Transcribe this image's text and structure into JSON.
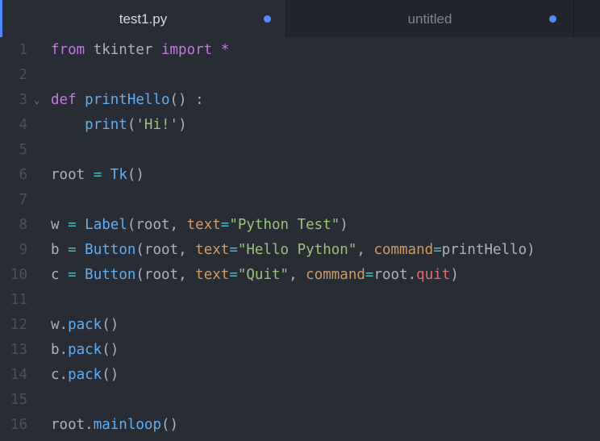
{
  "tabs": [
    {
      "label": "test1.py",
      "modified": true,
      "active": true
    },
    {
      "label": "untitled",
      "modified": true,
      "active": false
    }
  ],
  "line_numbers": [
    "1",
    "2",
    "3",
    "4",
    "5",
    "6",
    "7",
    "8",
    "9",
    "10",
    "11",
    "12",
    "13",
    "14",
    "15",
    "16"
  ],
  "fold_marker": "⌄",
  "code_lines": [
    [
      {
        "t": "from",
        "c": "kw"
      },
      {
        "t": " tkinter ",
        "c": "plain"
      },
      {
        "t": "import",
        "c": "kw"
      },
      {
        "t": " ",
        "c": "plain"
      },
      {
        "t": "*",
        "c": "kw"
      }
    ],
    [],
    [
      {
        "t": "def",
        "c": "kw"
      },
      {
        "t": " ",
        "c": "plain"
      },
      {
        "t": "printHello",
        "c": "fn"
      },
      {
        "t": "() :",
        "c": "plain"
      }
    ],
    [
      {
        "t": "    ",
        "c": "plain"
      },
      {
        "t": "print",
        "c": "fn"
      },
      {
        "t": "(",
        "c": "plain"
      },
      {
        "t": "'Hi!'",
        "c": "str"
      },
      {
        "t": ")",
        "c": "plain"
      }
    ],
    [],
    [
      {
        "t": "root ",
        "c": "plain"
      },
      {
        "t": "=",
        "c": "op"
      },
      {
        "t": " ",
        "c": "plain"
      },
      {
        "t": "Tk",
        "c": "fn"
      },
      {
        "t": "()",
        "c": "plain"
      }
    ],
    [],
    [
      {
        "t": "w ",
        "c": "plain"
      },
      {
        "t": "=",
        "c": "op"
      },
      {
        "t": " ",
        "c": "plain"
      },
      {
        "t": "Label",
        "c": "fn"
      },
      {
        "t": "(root, ",
        "c": "plain"
      },
      {
        "t": "text",
        "c": "kwarg"
      },
      {
        "t": "=",
        "c": "op"
      },
      {
        "t": "\"Python Test\"",
        "c": "str"
      },
      {
        "t": ")",
        "c": "plain"
      }
    ],
    [
      {
        "t": "b ",
        "c": "plain"
      },
      {
        "t": "=",
        "c": "op"
      },
      {
        "t": " ",
        "c": "plain"
      },
      {
        "t": "Button",
        "c": "fn"
      },
      {
        "t": "(root, ",
        "c": "plain"
      },
      {
        "t": "text",
        "c": "kwarg"
      },
      {
        "t": "=",
        "c": "op"
      },
      {
        "t": "\"Hello Python\"",
        "c": "str"
      },
      {
        "t": ", ",
        "c": "plain"
      },
      {
        "t": "command",
        "c": "kwarg"
      },
      {
        "t": "=",
        "c": "op"
      },
      {
        "t": "printHello)",
        "c": "plain"
      }
    ],
    [
      {
        "t": "c ",
        "c": "plain"
      },
      {
        "t": "=",
        "c": "op"
      },
      {
        "t": " ",
        "c": "plain"
      },
      {
        "t": "Button",
        "c": "fn"
      },
      {
        "t": "(root, ",
        "c": "plain"
      },
      {
        "t": "text",
        "c": "kwarg"
      },
      {
        "t": "=",
        "c": "op"
      },
      {
        "t": "\"Quit\"",
        "c": "str"
      },
      {
        "t": ", ",
        "c": "plain"
      },
      {
        "t": "command",
        "c": "kwarg"
      },
      {
        "t": "=",
        "c": "op"
      },
      {
        "t": "root.",
        "c": "plain"
      },
      {
        "t": "quit",
        "c": "red"
      },
      {
        "t": ")",
        "c": "plain"
      }
    ],
    [],
    [
      {
        "t": "w.",
        "c": "plain"
      },
      {
        "t": "pack",
        "c": "fn"
      },
      {
        "t": "()",
        "c": "plain"
      }
    ],
    [
      {
        "t": "b.",
        "c": "plain"
      },
      {
        "t": "pack",
        "c": "fn"
      },
      {
        "t": "()",
        "c": "plain"
      }
    ],
    [
      {
        "t": "c.",
        "c": "plain"
      },
      {
        "t": "pack",
        "c": "fn"
      },
      {
        "t": "()",
        "c": "plain"
      }
    ],
    [],
    [
      {
        "t": "root.",
        "c": "plain"
      },
      {
        "t": "mainloop",
        "c": "fn"
      },
      {
        "t": "()",
        "c": "plain"
      }
    ]
  ],
  "colors": {
    "background": "#282c34",
    "tab_bar": "#21252b",
    "modified_dot": "#528bff",
    "keyword": "#c678dd",
    "function": "#61afef",
    "string": "#98c379",
    "kwarg": "#d19a66",
    "operator": "#56b6c2",
    "attribute": "#e06c75",
    "plain": "#abb2bf",
    "line_number": "#495162"
  }
}
